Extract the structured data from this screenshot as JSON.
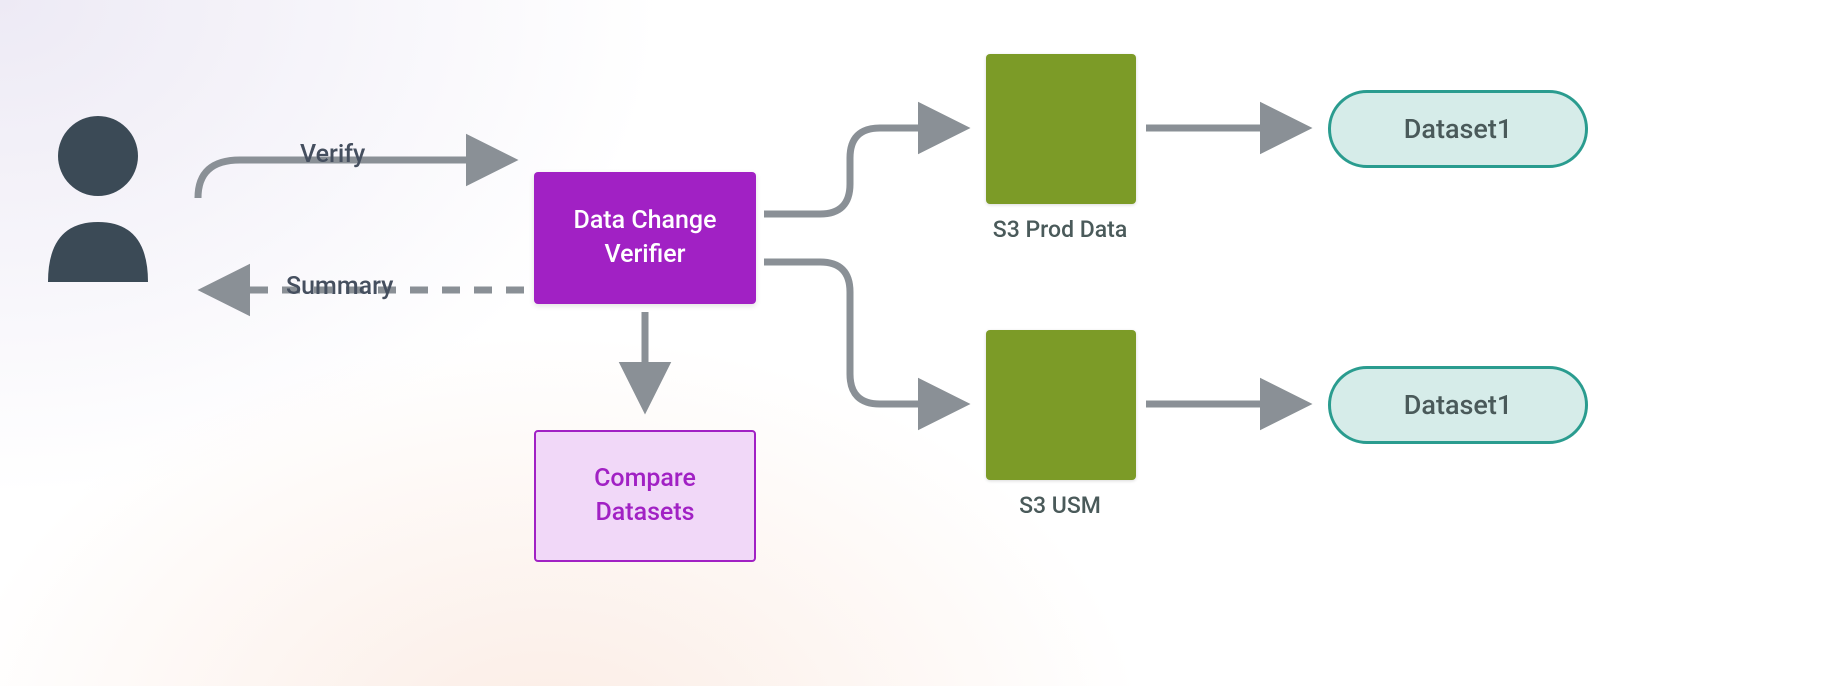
{
  "nodes": {
    "verifier": "Data Change\nVerifier",
    "compare": "Compare\nDatasets",
    "s3_top_label": "S3 Prod Data",
    "s3_bot_label": "S3 USM",
    "dataset_top": "Dataset1",
    "dataset_bot": "Dataset1"
  },
  "edges": {
    "verify": "Verify",
    "summary": "Summary"
  },
  "icons": {
    "user": "user-icon",
    "s3_top": "s3-bucket-icon",
    "s3_bot": "s3-bucket-icon"
  },
  "colors": {
    "arrow": "#8a9096",
    "verifier_bg": "#a121c4",
    "compare_bg": "#f1d8f8",
    "s3_bg": "#7c9b27",
    "dataset_border": "#2a9c8f",
    "user_fill": "#3b4a56"
  }
}
